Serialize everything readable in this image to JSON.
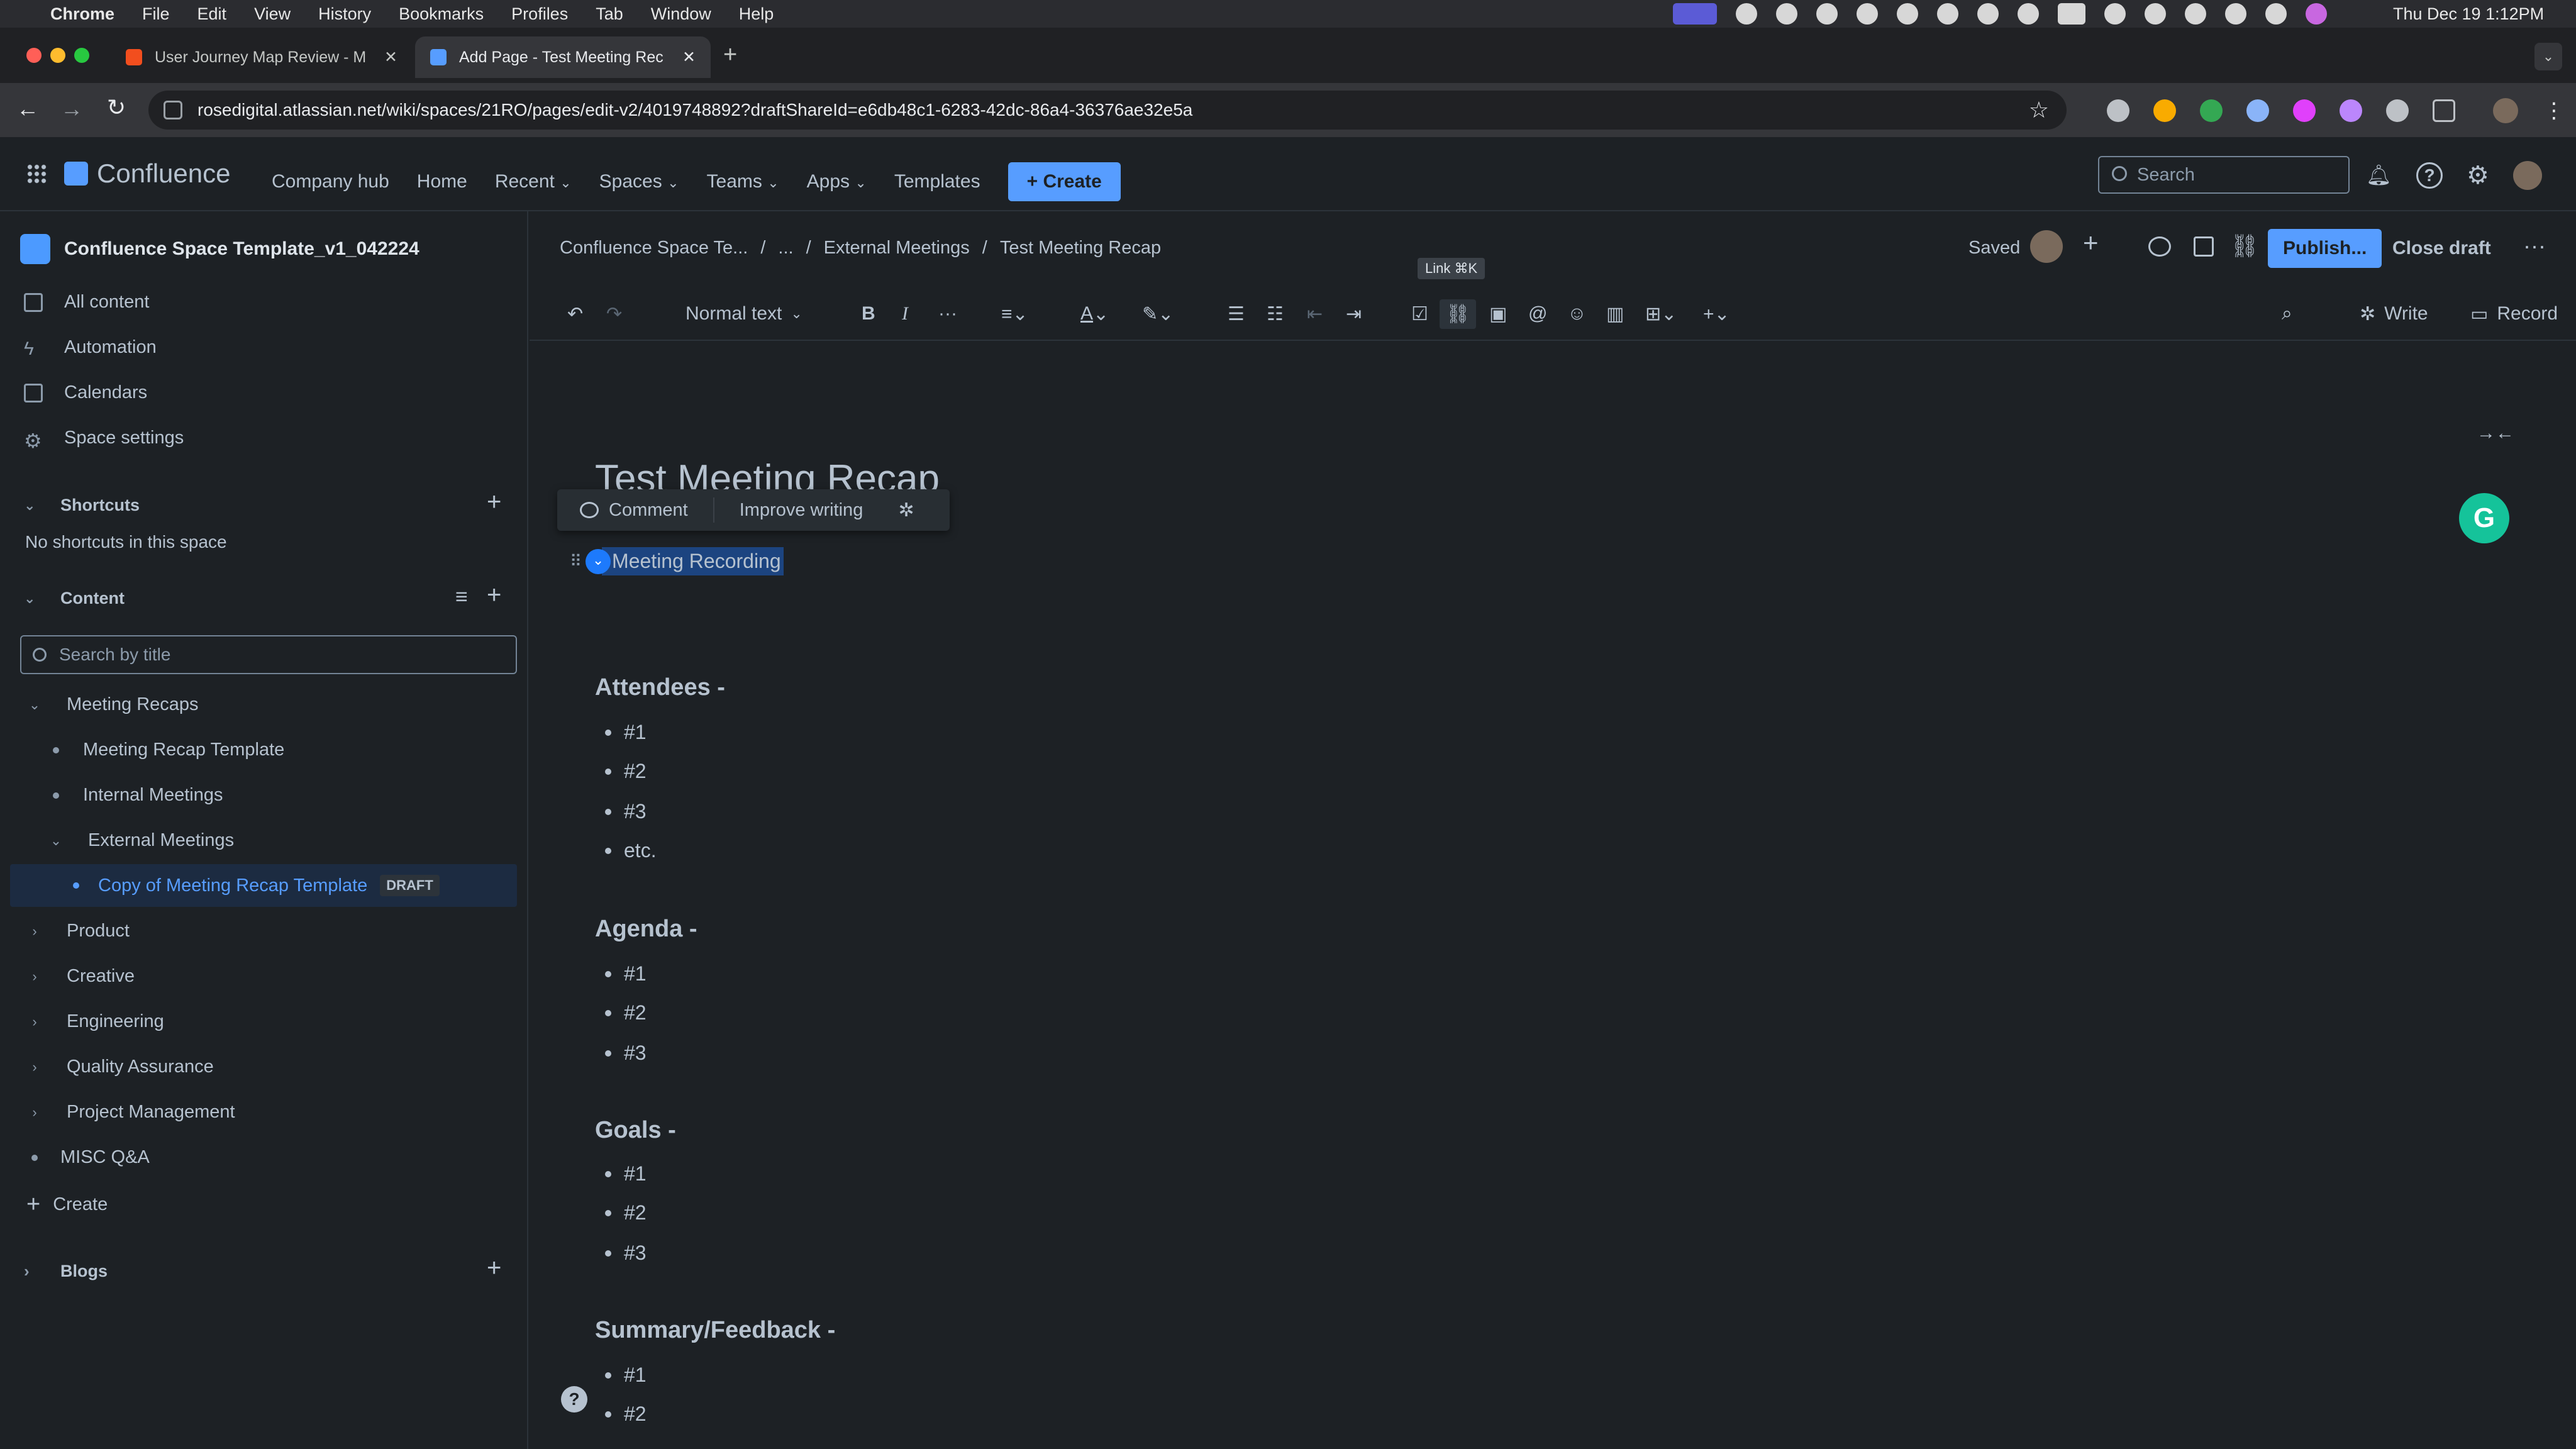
{
  "menubar": {
    "app": "Chrome",
    "items": [
      "File",
      "Edit",
      "View",
      "History",
      "Bookmarks",
      "Profiles",
      "Tab",
      "Window",
      "Help"
    ],
    "clock": "Thu Dec 19  1:12PM"
  },
  "browser": {
    "tabs": [
      {
        "title": "User Journey Map Review - M"
      },
      {
        "title": "Add Page - Test Meeting Rec"
      }
    ],
    "url": "rosedigital.atlassian.net/wiki/spaces/21RO/pages/edit-v2/4019748892?draftShareId=e6db48c1-6283-42dc-86a4-36376ae32e5a"
  },
  "topnav": {
    "brand": "Confluence",
    "links": [
      "Company hub",
      "Home",
      "Recent",
      "Spaces",
      "Teams",
      "Apps",
      "Templates"
    ],
    "create": "Create",
    "search_placeholder": "Search"
  },
  "sidebar": {
    "space_name": "Confluence Space Template_v1_042224",
    "items": [
      "All content",
      "Automation",
      "Calendars",
      "Space settings"
    ],
    "shortcuts_title": "Shortcuts",
    "shortcuts_empty": "No shortcuts in this space",
    "content_title": "Content",
    "search_placeholder": "Search by title",
    "tree": [
      {
        "label": "Meeting Recaps"
      },
      {
        "label": "Meeting Recap Template"
      },
      {
        "label": "Internal Meetings"
      },
      {
        "label": "External Meetings"
      },
      {
        "label": "Copy of Meeting Recap Template",
        "badge": "DRAFT"
      },
      {
        "label": "Product"
      },
      {
        "label": "Creative"
      },
      {
        "label": "Engineering"
      },
      {
        "label": "Quality Assurance"
      },
      {
        "label": "Project Management"
      },
      {
        "label": "MISC Q&A"
      }
    ],
    "create": "Create",
    "blogs_title": "Blogs"
  },
  "header": {
    "breadcrumb": [
      "Confluence Space Te...",
      "...",
      "External Meetings",
      "Test Meeting Recap"
    ],
    "saved": "Saved",
    "publish": "Publish...",
    "close_draft": "Close draft",
    "tooltip": "Link ⌘K"
  },
  "toolbar": {
    "text_style": "Normal text",
    "write": "Write",
    "record": "Record"
  },
  "editor": {
    "title": "Test Meeting Recap",
    "popup_comment": "Comment",
    "popup_improve": "Improve writing",
    "selected_text": "Meeting Recording",
    "sections": [
      {
        "heading": "Attendees -",
        "items": [
          "#1",
          "#2",
          "#3",
          "etc."
        ]
      },
      {
        "heading": "Agenda -",
        "items": [
          "#1",
          "#2",
          "#3"
        ]
      },
      {
        "heading": "Goals -",
        "items": [
          "#1",
          "#2",
          "#3"
        ]
      },
      {
        "heading": "Summary/Feedback -",
        "items": [
          "#1",
          "#2"
        ]
      }
    ]
  },
  "colors": {
    "accent": "#579dff",
    "background": "#1d2125",
    "text": "#b6c2cf"
  }
}
